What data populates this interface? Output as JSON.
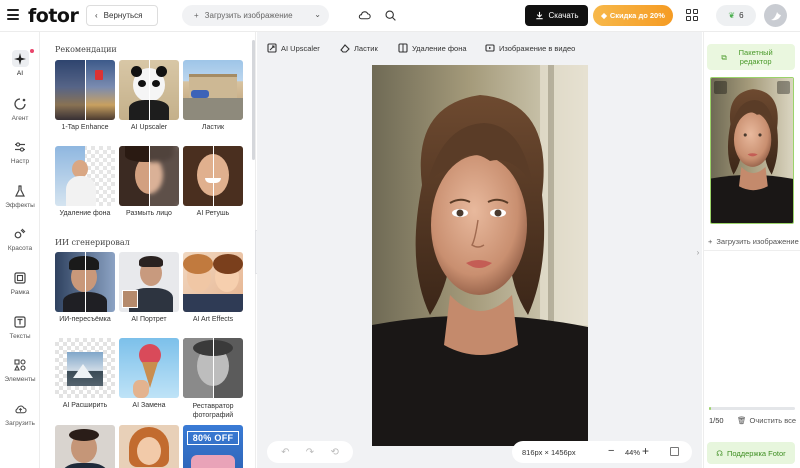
{
  "header": {
    "logo": "fotor",
    "back_label": "Вернуться",
    "upload_label": "Загрузить изображение",
    "download_label": "Скачать",
    "discount_label": "Скидка до 20%",
    "credits": "6"
  },
  "leftnav": {
    "items": [
      {
        "label": "AI",
        "icon": "sparkle-icon"
      },
      {
        "label": "Агент",
        "icon": "agent-icon"
      },
      {
        "label": "Настр",
        "icon": "sliders-icon"
      },
      {
        "label": "Эффекты",
        "icon": "flask-icon"
      },
      {
        "label": "Красота",
        "icon": "beauty-icon"
      },
      {
        "label": "Рамка",
        "icon": "frame-icon"
      },
      {
        "label": "Тексты",
        "icon": "text-icon"
      },
      {
        "label": "Элементы",
        "icon": "elements-icon"
      },
      {
        "label": "Загрузить",
        "icon": "upload-cloud-icon"
      }
    ]
  },
  "tools_panel": {
    "section1_title": "Рекомендации",
    "section1": [
      "1-Tap Enhance",
      "AI Upscaler",
      "Ластик",
      "Удаление фона",
      "Размыть лицо",
      "AI Ретушь"
    ],
    "section2_title": "ИИ сгенерировал",
    "section2": [
      "ИИ-пересъёмка",
      "AI Портрет",
      "AI Art Effects",
      "AI Расширить",
      "AI Замена",
      "Реставратор фотографий"
    ],
    "promo_text": "80% OFF"
  },
  "canvas": {
    "tools": [
      {
        "label": "AI Upscaler",
        "icon": "upscale-icon"
      },
      {
        "label": "Ластик",
        "icon": "eraser-icon"
      },
      {
        "label": "Удаление фона",
        "icon": "bg-remove-icon"
      },
      {
        "label": "Изображение в видео",
        "icon": "video-icon"
      }
    ],
    "dimensions": "816px × 1456px",
    "zoom": "44%"
  },
  "rightpanel": {
    "batch_label": "Пакетный редактор",
    "add_upload_label": "Загрузить изображение",
    "count": "1/50",
    "clear_label": "Очистить все",
    "support_label": "Поддержка Fotor",
    "progress": 0.02
  },
  "colors": {
    "accent_green": "#9bd36a",
    "discount_orange": "#f59b23",
    "download_black": "#111111"
  }
}
